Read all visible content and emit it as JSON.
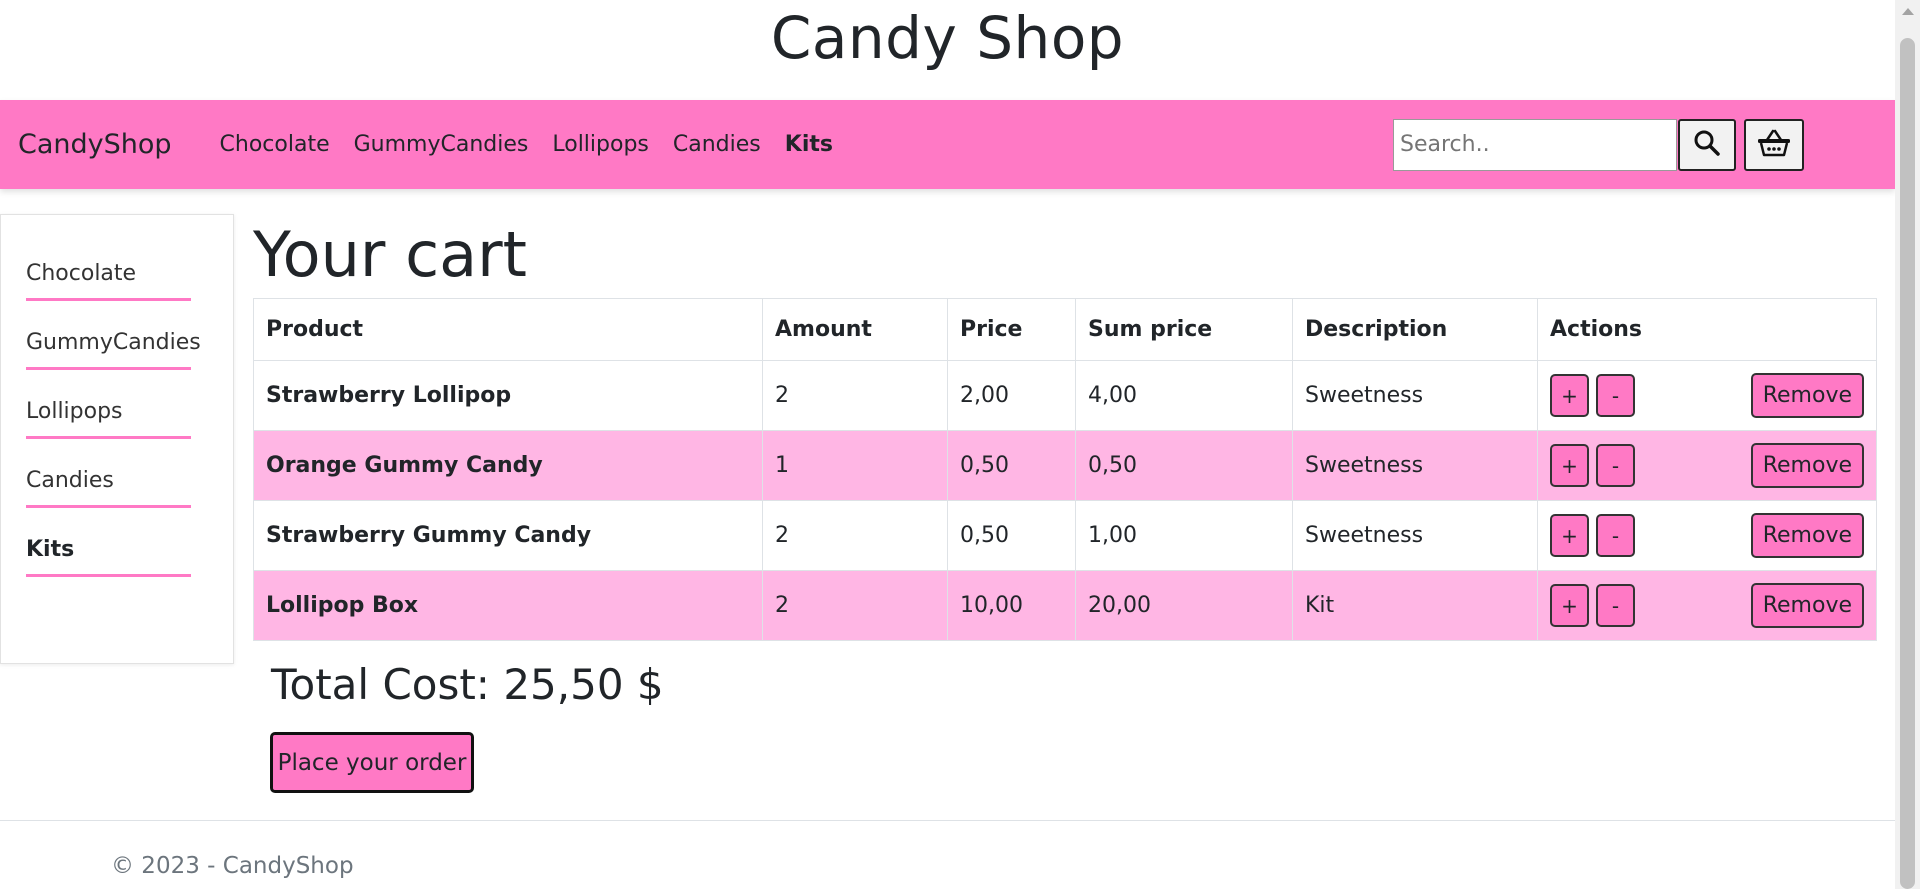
{
  "header": {
    "title": "Candy Shop"
  },
  "navbar": {
    "brand": "CandyShop",
    "links": [
      {
        "label": "Chocolate",
        "active": false
      },
      {
        "label": "GummyCandies",
        "active": false
      },
      {
        "label": "Lollipops",
        "active": false
      },
      {
        "label": "Candies",
        "active": false
      },
      {
        "label": "Kits",
        "active": true
      }
    ],
    "search": {
      "placeholder": "Search..",
      "value": ""
    },
    "search_icon": "search-icon",
    "cart_icon": "shopping-basket-icon"
  },
  "sidebar": {
    "items": [
      {
        "label": "Chocolate",
        "active": false
      },
      {
        "label": "GummyCandies",
        "active": false
      },
      {
        "label": "Lollipops",
        "active": false
      },
      {
        "label": "Candies",
        "active": false
      },
      {
        "label": "Kits",
        "active": true
      }
    ]
  },
  "cart": {
    "title": "Your cart",
    "columns": [
      "Product",
      "Amount",
      "Price",
      "Sum price",
      "Description",
      "Actions"
    ],
    "rows": [
      {
        "product": "Strawberry Lollipop",
        "amount": "2",
        "price": "2,00",
        "sum": "4,00",
        "description": "Sweetness"
      },
      {
        "product": "Orange Gummy Candy",
        "amount": "1",
        "price": "0,50",
        "sum": "0,50",
        "description": "Sweetness"
      },
      {
        "product": "Strawberry Gummy Candy",
        "amount": "2",
        "price": "0,50",
        "sum": "1,00",
        "description": "Sweetness"
      },
      {
        "product": "Lollipop Box",
        "amount": "2",
        "price": "10,00",
        "sum": "20,00",
        "description": "Kit"
      }
    ],
    "actions": {
      "increase_label": "+",
      "decrease_label": "-",
      "remove_label": "Remove"
    },
    "total_label": "Total Cost: 25,50 $",
    "order_button": "Place your order"
  },
  "footer": {
    "text": "© 2023 - CandyShop"
  },
  "colors": {
    "accent": "#ff79c5",
    "stripe": "#ffb6e4"
  }
}
